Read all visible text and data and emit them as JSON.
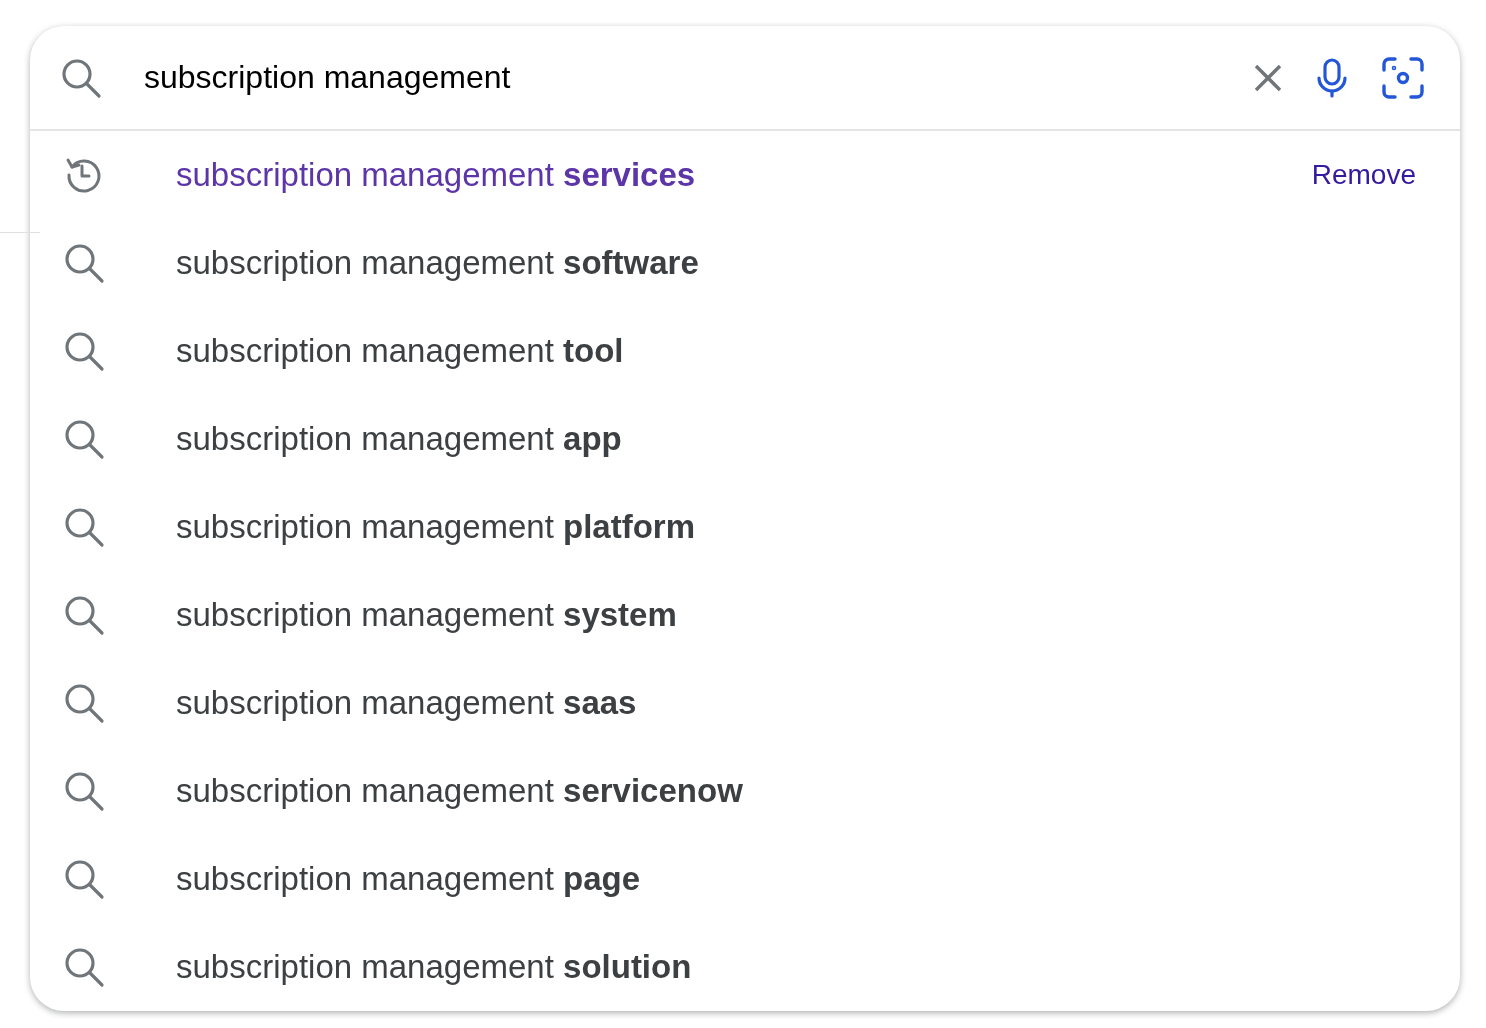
{
  "search": {
    "value": "subscription management"
  },
  "suggestions": [
    {
      "kind": "history",
      "text": "subscription management **services**",
      "action": "Remove"
    },
    {
      "kind": "search",
      "text": "subscription management **software**"
    },
    {
      "kind": "search",
      "text": "subscription management **tool**"
    },
    {
      "kind": "search",
      "text": "subscription management **app**"
    },
    {
      "kind": "search",
      "text": "subscription management **platform**"
    },
    {
      "kind": "search",
      "text": "subscription management **system**"
    },
    {
      "kind": "search",
      "text": "subscription management **saas**"
    },
    {
      "kind": "search",
      "text": "subscription management **servicenow**"
    },
    {
      "kind": "search",
      "text": "subscription management **page**"
    },
    {
      "kind": "search",
      "text": "subscription management **solution**"
    }
  ]
}
